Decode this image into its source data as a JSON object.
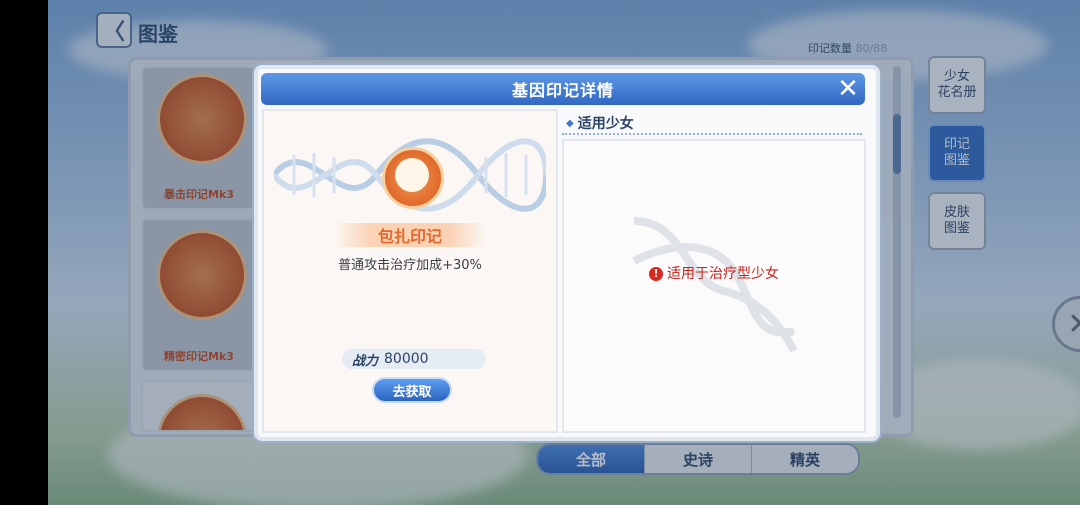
{
  "header": {
    "back_glyph": "〈",
    "title": "图鉴"
  },
  "counter": {
    "label": "印记数量",
    "value": "80/88"
  },
  "cards": [
    {
      "label": "暴击印记Mk3"
    },
    {
      "label": "精密印记Mk3"
    },
    {
      "label": ""
    }
  ],
  "side_tabs": [
    {
      "label": "少女\n花名册",
      "active": false
    },
    {
      "label": "印记\n图鉴",
      "active": true
    },
    {
      "label": "皮肤\n图鉴",
      "active": false
    }
  ],
  "filters": [
    {
      "label": "全部",
      "active": true
    },
    {
      "label": "史诗",
      "active": false
    },
    {
      "label": "精英",
      "active": false
    }
  ],
  "dialog": {
    "title": "基因印记详情",
    "close_glyph": "✕",
    "mark": {
      "name": "包扎印记",
      "description": "普通攻击治疗加成+30%",
      "power_label": "战力",
      "power_value": "80000",
      "get_button": "去获取"
    },
    "girls": {
      "section_title": "适用少女",
      "warning_icon": "!",
      "warning": "适用于治疗型少女"
    }
  },
  "colors": {
    "accent_blue": "#3268c2",
    "mark_orange": "#e4682d",
    "warning_red": "#c7231d"
  }
}
